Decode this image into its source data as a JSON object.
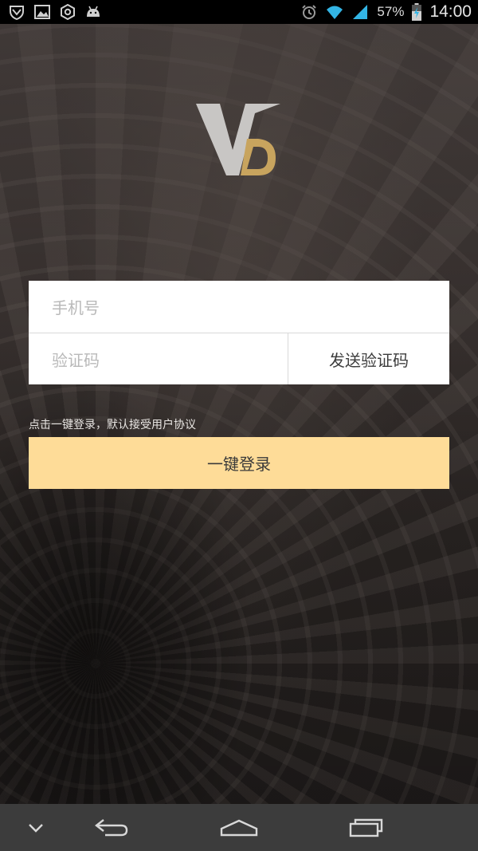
{
  "status_bar": {
    "left_icons": [
      "shield-icon",
      "image-icon",
      "hexagon-settings-icon",
      "android-icon"
    ],
    "right_icons": [
      "alarm-icon",
      "wifi-icon",
      "signal-icon",
      "battery-charging-icon"
    ],
    "battery": "57%",
    "time": "14:00"
  },
  "logo": {
    "icon": "vd-logo-icon",
    "colors": {
      "v": "#c8c6c4",
      "d": "#c8a45e"
    }
  },
  "form": {
    "phone_placeholder": "手机号",
    "code_placeholder": "验证码",
    "send_code_label": "发送验证码"
  },
  "agreement_text": "点击一键登录，默认接受用户协议",
  "login_label": "一键登录",
  "nav_bar": {
    "icons": [
      "chevron-down-icon",
      "back-icon",
      "home-icon",
      "recents-icon"
    ]
  },
  "colors": {
    "login_button": "#fedc98",
    "nav_bar": "#3c3c3c"
  }
}
